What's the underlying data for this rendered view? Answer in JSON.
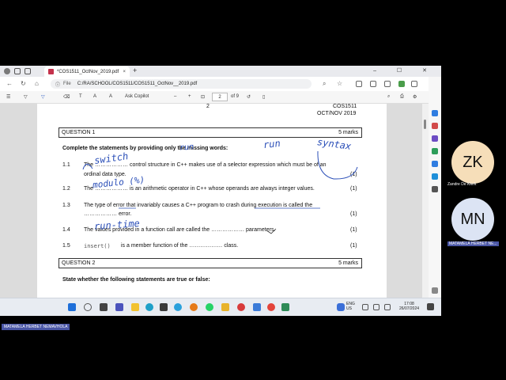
{
  "browser": {
    "tab_title": "*COS1511_OctNov_2019.pdf",
    "new_tab": "+",
    "close": "×",
    "window_controls": "– ☐ ✕",
    "address_prefix": "File",
    "address": "C:/RA/SCHOOL/COS1511/COS1511_OctNov__2019.pdf"
  },
  "pdf_toolbar": {
    "ask_copilot": "Ask Copilot",
    "zoom_out": "–",
    "zoom_in": "+",
    "page_current": "2",
    "page_total": "of 9"
  },
  "document": {
    "page_number": "2",
    "course_code": "COS1511",
    "exam_date": "OCT/NOV 2019",
    "q1_title": "QUESTION 1",
    "q1_marks": "5 marks",
    "instruction1": "Complete the statements by providing only the missing words:",
    "items": [
      {
        "num": "1.1",
        "line1": "The ……………… control structure in C++ makes use of a selector expression which must be of an",
        "line2": "ordinal data type.",
        "mark": "(1)"
      },
      {
        "num": "1.2",
        "line1": "The ……………… is an arithmetic operator in C++ whose operands are always integer values.",
        "mark": "(1)"
      },
      {
        "num": "1.3",
        "line1": "The type of error that invariably causes a C++ program to crash during execution is called the",
        "line2": "……………… error.",
        "mark": "(1)"
      },
      {
        "num": "1.4",
        "line1": "The values provided in a function call are called the ……………… parameters.",
        "mark": "(1)"
      },
      {
        "num": "1.5",
        "code": "insert()",
        "line1": "is a member function of the ……………… class.",
        "mark": "(1)"
      }
    ],
    "q2_title": "QUESTION 2",
    "q2_marks": "5 marks",
    "instruction2": "State whether the following statements are true or false:",
    "handwriting": {
      "a1": "switch",
      "a2": "modulo (%)",
      "a3": "run-time",
      "a3b": "run",
      "a3c": "syntax",
      "scribble": "run"
    }
  },
  "taskbar": {
    "lang_top": "ENG",
    "lang_bottom": "US",
    "time": "17:08",
    "date": "26/07/2024"
  },
  "participants": [
    {
      "initials": "ZK",
      "name": "Zandre De Klerk",
      "color": "#f6deb9"
    },
    {
      "initials": "MN",
      "name": "MATAMELA HERBET NE...",
      "color": "#dce4f4"
    }
  ],
  "presenter_name": "MATAMELA HERBET NEMAVHOLA"
}
